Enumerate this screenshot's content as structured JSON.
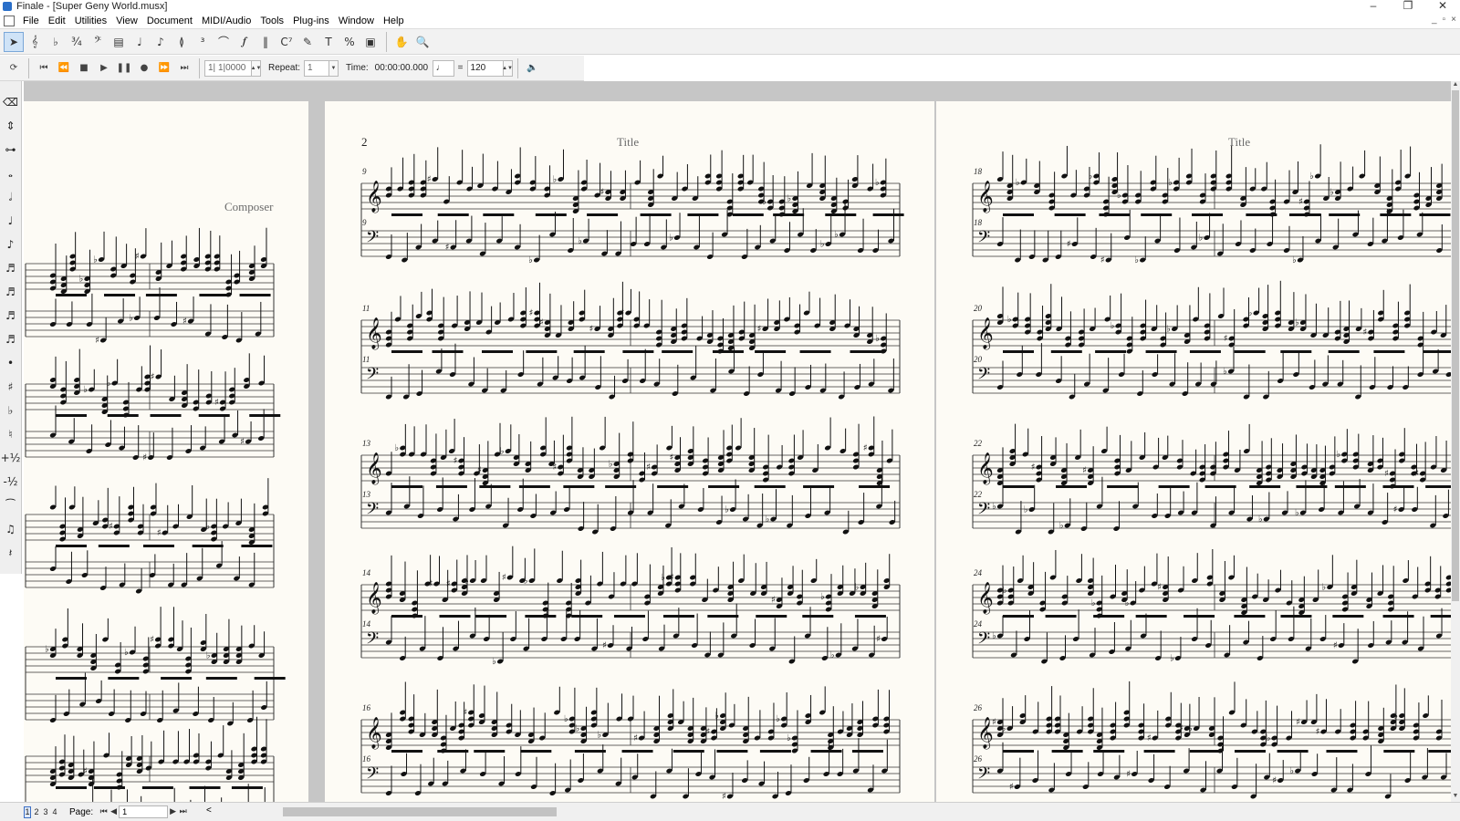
{
  "window": {
    "title": "Finale - [Super Geny World.musx]",
    "controls": [
      "–",
      "❐",
      "✕"
    ]
  },
  "menubar": {
    "items": [
      "File",
      "Edit",
      "Utilities",
      "View",
      "Document",
      "MIDI/Audio",
      "Tools",
      "Plug-ins",
      "Window",
      "Help"
    ]
  },
  "toolbar": {
    "tools": [
      {
        "name": "selection-tool-icon",
        "glyph": "➤",
        "active": true
      },
      {
        "name": "staff-tool-icon",
        "glyph": "𝄞"
      },
      {
        "name": "key-signature-tool-icon",
        "glyph": "♭"
      },
      {
        "name": "time-signature-tool-icon",
        "glyph": "¾"
      },
      {
        "name": "clef-tool-icon",
        "glyph": "𝄢"
      },
      {
        "name": "measure-tool-icon",
        "glyph": "▤"
      },
      {
        "name": "simple-entry-tool-icon",
        "glyph": "♩"
      },
      {
        "name": "speedy-entry-tool-icon",
        "glyph": "♪"
      },
      {
        "name": "articulation-tool-icon",
        "glyph": "≬"
      },
      {
        "name": "tuplet-tool-icon",
        "glyph": "³"
      },
      {
        "name": "smart-shape-tool-icon",
        "glyph": "⌒"
      },
      {
        "name": "expression-tool-icon",
        "glyph": "𝆑"
      },
      {
        "name": "repeat-tool-icon",
        "glyph": "‖"
      },
      {
        "name": "chord-tool-icon",
        "glyph": "C⁷"
      },
      {
        "name": "lyrics-tool-icon",
        "glyph": "✎"
      },
      {
        "name": "text-tool-icon",
        "glyph": "T"
      },
      {
        "name": "resize-tool-icon",
        "glyph": "%"
      },
      {
        "name": "graphics-tool-icon",
        "glyph": "▣"
      }
    ],
    "view_tools": [
      {
        "name": "hand-grabber-icon",
        "glyph": "✋"
      },
      {
        "name": "zoom-icon",
        "glyph": "🔍"
      }
    ]
  },
  "playback": {
    "buttons": [
      {
        "name": "rewind-to-start-icon",
        "glyph": "⏮"
      },
      {
        "name": "rewind-icon",
        "glyph": "⏪"
      },
      {
        "name": "stop-icon",
        "glyph": "■"
      },
      {
        "name": "play-icon",
        "glyph": "▶"
      },
      {
        "name": "pause-icon",
        "glyph": "❚❚"
      },
      {
        "name": "record-icon",
        "glyph": "●"
      },
      {
        "name": "fast-forward-icon",
        "glyph": "⏩"
      },
      {
        "name": "forward-to-end-icon",
        "glyph": "⏭"
      }
    ],
    "counter": "1| 1|0000",
    "repeat_label": "Repeat:",
    "repeat_value": "1",
    "time_label": "Time:",
    "time_value": "00:00:00.000",
    "tempo_equals": "=",
    "tempo_value": "120"
  },
  "palette": {
    "items": [
      "eraser-icon",
      "nudge-icon",
      "tuplet-bracket-icon",
      "whole-note-icon",
      "half-note-icon",
      "quarter-note-icon",
      "eighth-note-icon",
      "sixteenth-note-icon",
      "thirty-second-note-icon",
      "sixty-fourth-note-icon",
      "one-twenty-eighth-note-icon",
      "dot-icon",
      "sharp-icon",
      "flat-icon",
      "natural-icon",
      "half-step-up-icon",
      "half-step-down-icon",
      "tie-icon",
      "grace-note-icon",
      "rest-icon"
    ],
    "glyphs": [
      "⌫",
      "⇕",
      "⊶",
      "𝅝",
      "𝅗𝅥",
      "♩",
      "♪",
      "♬",
      "♬",
      "♬",
      "♬",
      "•",
      "♯",
      "♭",
      "♮",
      "+½",
      "-½",
      "⁀",
      "♫",
      "𝄽"
    ]
  },
  "score": {
    "page_left": {
      "composer": "Composer"
    },
    "page_center": {
      "page_number": "2",
      "title": "Title",
      "measure_numbers": [
        "9",
        "9",
        "11",
        "11",
        "13",
        "13",
        "14",
        "14",
        "16",
        "16"
      ]
    },
    "page_right": {
      "title": "Title",
      "measure_numbers": [
        "18",
        "18",
        "20",
        "20",
        "22",
        "22",
        "24",
        "24",
        "26",
        "26"
      ]
    }
  },
  "statusbar": {
    "page_tabs": [
      "1",
      "2",
      "3",
      "4"
    ],
    "active_page_tab": 0,
    "page_label": "Page:",
    "page_value": "1",
    "nav": {
      "first": "⏮",
      "prev": "◀",
      "next": "▶",
      "last": "⏭",
      "scroll_left": "<"
    }
  },
  "colors": {
    "paper": "#fdfbf5",
    "canvas": "#c6c6c6",
    "toolbar": "#f2f2f2",
    "selection_accent": "#7aa7d8",
    "ink": "#111111"
  }
}
